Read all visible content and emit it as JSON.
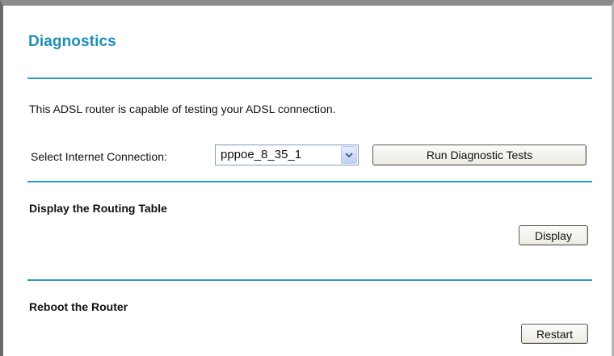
{
  "page": {
    "title": "Diagnostics",
    "description": "This ADSL router is capable of testing your ADSL connection."
  },
  "connection": {
    "label": "Select Internet Connection:",
    "selected": "pppoe_8_35_1",
    "run_button": "Run Diagnostic Tests"
  },
  "routing": {
    "heading": "Display the Routing Table",
    "button": "Display"
  },
  "reboot": {
    "heading": "Reboot the Router",
    "button": "Restart"
  },
  "colors": {
    "accent": "#1e8fb3",
    "rule": "#2a9bbd"
  },
  "icons": {
    "select_arrow": "chevron-down-icon"
  }
}
